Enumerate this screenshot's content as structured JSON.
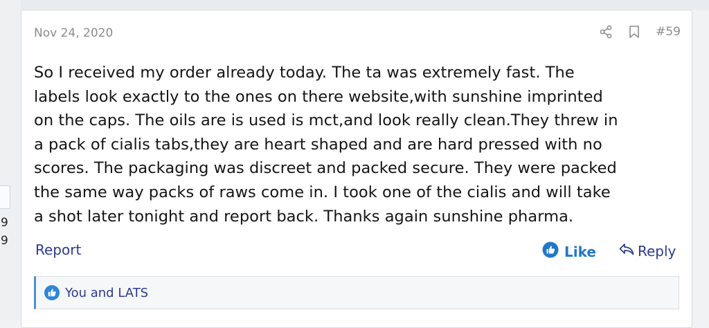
{
  "sidebar_fragment": {
    "numbers": [
      "9",
      "9"
    ]
  },
  "post": {
    "date": "Nov 24, 2020",
    "post_number": "#59",
    "share_icon": "share-icon",
    "bookmark_icon": "bookmark-icon",
    "body_lines": [
      "So I received my order already today. The ta was extremely fast. The",
      "labels look exactly to the ones on there website,with sunshine imprinted",
      "on the caps. The oils are is used is mct,and look really clean.They threw in",
      "a pack of cialis tabs,they are heart shaped and are hard pressed with no",
      "scores. The packaging was discreet and packed secure. They were packed",
      "the same way packs of raws come in. I took one of the cialis and will take",
      "a shot later tonight and report back. Thanks again sunshine pharma."
    ],
    "report_label": "Report",
    "like_label": "Like",
    "reply_label": "Reply",
    "reactions_text": "You and LATS"
  },
  "colors": {
    "link": "#2b3a8c",
    "like_blue": "#1f78c8",
    "muted": "#8c8c8c",
    "accent_border": "#4a8fd4"
  }
}
